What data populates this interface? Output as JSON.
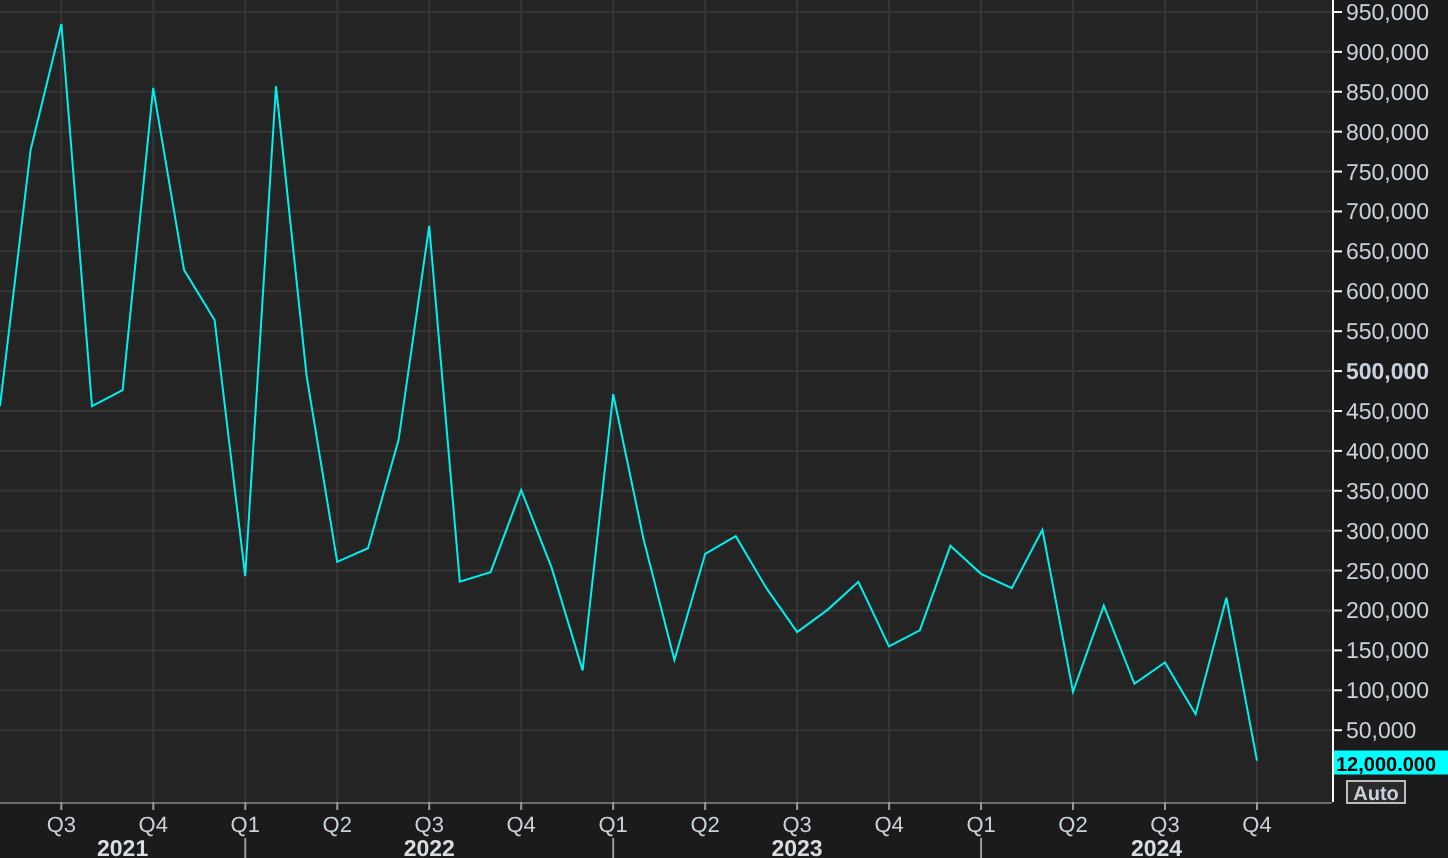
{
  "chart": {
    "chart_data": {
      "type": "line",
      "categories": [
        null,
        null,
        "Q3",
        null,
        null,
        "Q4",
        null,
        null,
        "Q1",
        null,
        null,
        "Q2",
        null,
        null,
        "Q3",
        null,
        null,
        "Q4",
        null,
        null,
        "Q1",
        null,
        null,
        "Q2",
        null,
        null,
        "Q3",
        null,
        null,
        "Q4",
        null,
        null,
        "Q1",
        null,
        null,
        "Q2",
        null,
        null,
        "Q3",
        null,
        null,
        "Q4"
      ],
      "series": [
        {
          "color": "#00f0f0",
          "values": [
            456000,
            777000,
            935000,
            456000,
            476000,
            855000,
            627000,
            564000,
            243000,
            857000,
            494000,
            261000,
            278000,
            414000,
            682000,
            236000,
            248000,
            351000,
            253000,
            125000,
            471000,
            288000,
            138000,
            271000,
            293000,
            228000,
            173000,
            201000,
            236000,
            155000,
            175000,
            281000,
            246000,
            228000,
            301000,
            98000,
            206000,
            108000,
            135000,
            70000,
            216000,
            12000
          ]
        }
      ],
      "ylim": [
        -40000,
        965000
      ],
      "grid": true,
      "yticks": [
        {
          "value": 950000,
          "label": "950,000"
        },
        {
          "value": 900000,
          "label": "900,000"
        },
        {
          "value": 850000,
          "label": "850,000"
        },
        {
          "value": 800000,
          "label": "800,000"
        },
        {
          "value": 750000,
          "label": "750,000"
        },
        {
          "value": 700000,
          "label": "700,000"
        },
        {
          "value": 650000,
          "label": "650,000"
        },
        {
          "value": 600000,
          "label": "600,000"
        },
        {
          "value": 550000,
          "label": "550,000"
        },
        {
          "value": 500000,
          "label": "500,000"
        },
        {
          "value": 450000,
          "label": "450,000"
        },
        {
          "value": 400000,
          "label": "400,000"
        },
        {
          "value": 350000,
          "label": "350,000"
        },
        {
          "value": 300000,
          "label": "300,000"
        },
        {
          "value": 250000,
          "label": "250,000"
        },
        {
          "value": 200000,
          "label": "200,000"
        },
        {
          "value": 150000,
          "label": "150,000"
        },
        {
          "value": 100000,
          "label": "100,000"
        },
        {
          "value": 50000,
          "label": "50,000"
        }
      ]
    },
    "year_labels": [
      "2021",
      "2022",
      "2023",
      "2024"
    ],
    "last_value_label": "12,000.000",
    "scale_button": "Auto"
  }
}
